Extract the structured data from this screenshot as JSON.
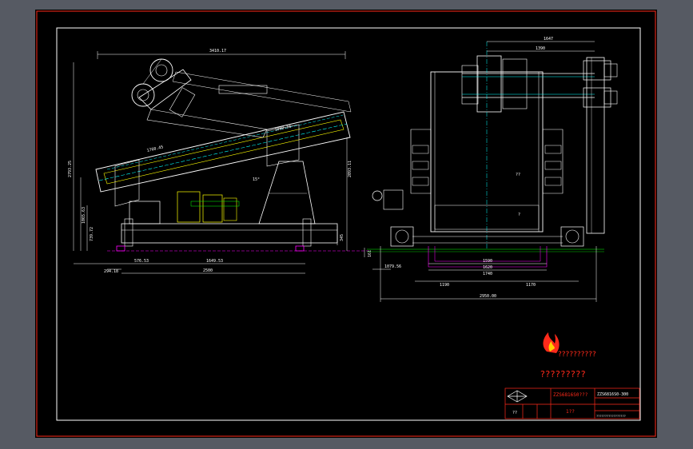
{
  "side_view": {
    "dim_overall_length": "3410.17",
    "dim_height_left": "2793.25",
    "dim_height_right": "2093.11",
    "dim_incline_upper": "1080.16",
    "dim_incline_lower": "1760.45",
    "dim_left_mid": "1065.63",
    "dim_left_low": "739.72",
    "dim_base_height": "345",
    "dim_bottom_left": "294.18",
    "dim_span_1": "576.53",
    "dim_span_2": "1649.53",
    "dim_total": "2500",
    "dim_foot": "161",
    "angle_label": "15°"
  },
  "end_view": {
    "dim_top_1": "1647",
    "dim_top_2": "1390",
    "dim_left_offset": "1079.56",
    "dim_inner_1": "1590",
    "dim_inner_2": "1620",
    "dim_inner_3": "1740",
    "dim_half_left": "1190",
    "dim_half_right": "1170",
    "dim_overall": "2950.00",
    "mark_center": "??",
    "mark_lower": "?"
  },
  "watermark": {
    "line1": "??????????",
    "line2": "?????????"
  },
  "title_block": {
    "drawing_name": "ZZS6816S0???",
    "drawing_code": "ZZS6816S0-300",
    "scale_label": "1??",
    "footer_text": "?????????????????",
    "logo_text": "??"
  },
  "colors": {
    "page_bg": "#565a63",
    "sheet_bg": "#000000",
    "frame_red": "#ff2a1a",
    "line_white": "#ffffff",
    "line_yellow": "#ffff00",
    "line_cyan": "#00ffff",
    "line_green": "#00ff00",
    "line_magenta": "#ff00ff"
  }
}
